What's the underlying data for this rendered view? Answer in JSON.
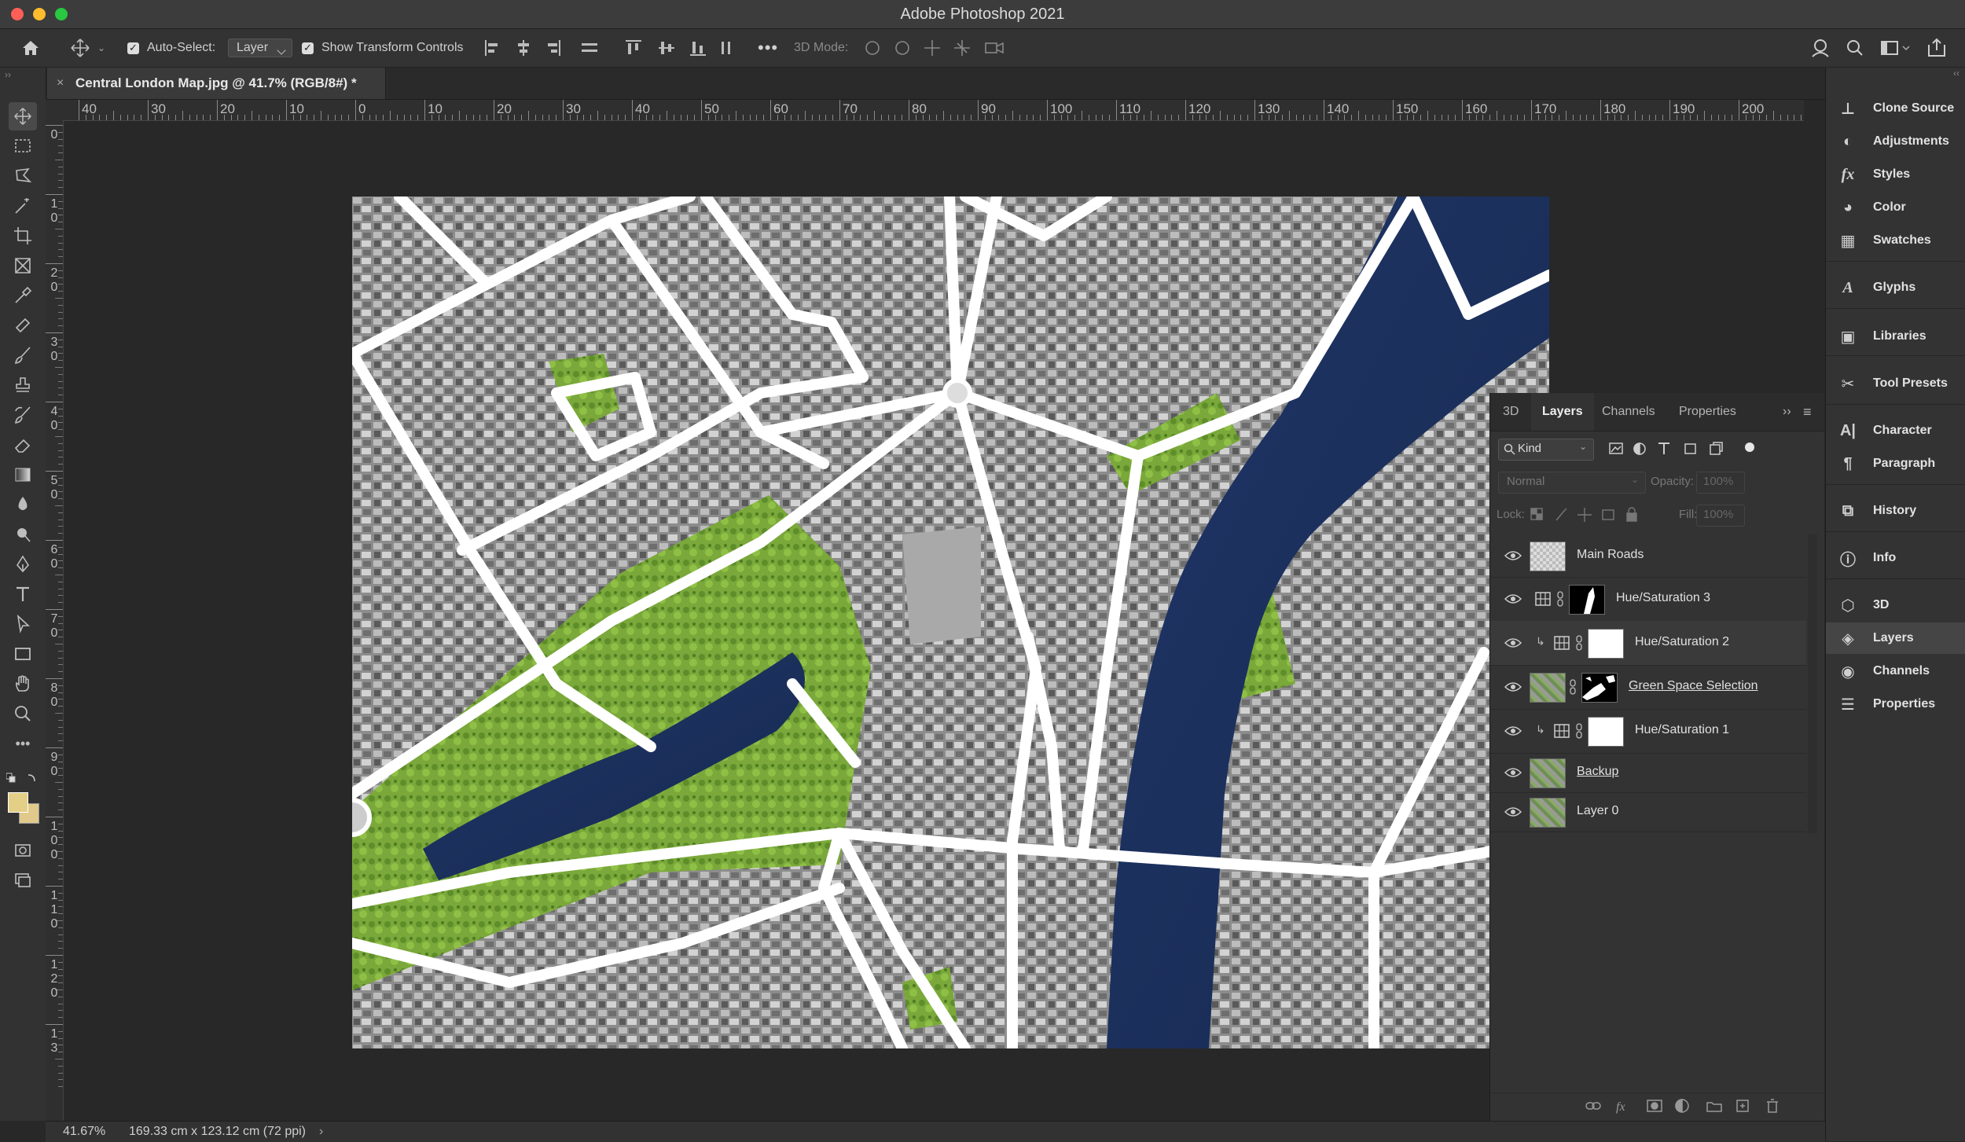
{
  "window": {
    "title": "Adobe Photoshop 2021"
  },
  "options_bar": {
    "auto_select_label": "Auto-Select:",
    "auto_select_value": "Layer",
    "show_transform_label": "Show Transform Controls",
    "mode_3d_label": "3D Mode:"
  },
  "document": {
    "tab_title": "Central London Map.jpg @ 41.7% (RGB/8#) *"
  },
  "rulers": {
    "horizontal": [
      "40",
      "30",
      "20",
      "10",
      "0",
      "10",
      "20",
      "30",
      "40",
      "50",
      "60",
      "70",
      "80",
      "90",
      "100",
      "110",
      "120",
      "130",
      "140",
      "150",
      "160",
      "170",
      "180",
      "190",
      "200"
    ],
    "vertical": [
      "0",
      "1\n0",
      "2\n0",
      "3\n0",
      "4\n0",
      "5\n0",
      "6\n0",
      "7\n0",
      "8\n0",
      "9\n0",
      "1\n0\n0",
      "1\n1\n0",
      "1\n2\n0",
      "1\n3"
    ]
  },
  "layers_panel": {
    "tabs": [
      "3D",
      "Layers",
      "Channels",
      "Properties"
    ],
    "active_tab": "Layers",
    "filter_kind": "Kind",
    "blend_mode": "Normal",
    "opacity_label": "Opacity:",
    "opacity_value": "100%",
    "lock_label": "Lock:",
    "fill_label": "Fill:",
    "fill_value": "100%",
    "layers": [
      {
        "name": "Main Roads"
      },
      {
        "name": "Hue/Saturation 3"
      },
      {
        "name": "Hue/Saturation 2"
      },
      {
        "name": "Green Space Selection"
      },
      {
        "name": "Hue/Saturation 1"
      },
      {
        "name": "Backup"
      },
      {
        "name": "Layer 0"
      }
    ]
  },
  "right_dock": {
    "items": [
      "Clone Source",
      "Adjustments",
      "Styles",
      "Color",
      "Swatches",
      "Glyphs",
      "Libraries",
      "Tool Presets",
      "Character",
      "Paragraph",
      "History",
      "Info",
      "3D",
      "Layers",
      "Channels",
      "Properties"
    ],
    "active_item": "Layers"
  },
  "status_bar": {
    "zoom": "41.67%",
    "doc_info": "169.33 cm x 123.12 cm (72 ppi)"
  },
  "colors": {
    "foreground": "#e3cf86",
    "background": "#e0c98a",
    "accent_green": "#7cb33a",
    "water": "#1d2f59"
  }
}
